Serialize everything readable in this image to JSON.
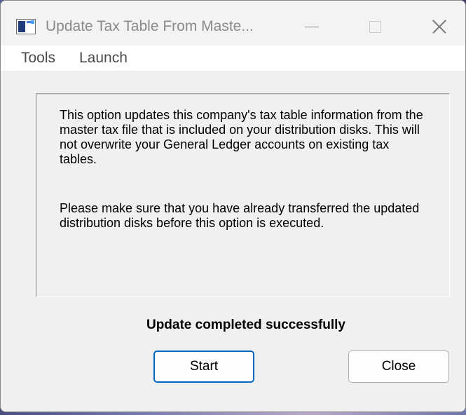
{
  "window": {
    "title": "Update Tax Table From Maste...",
    "controls": {
      "minimize_icon": "minimize-icon",
      "maximize_icon": "maximize-icon",
      "close_icon": "close-icon"
    }
  },
  "menu": {
    "items": [
      {
        "label": "Tools"
      },
      {
        "label": "Launch"
      }
    ]
  },
  "info": {
    "paragraph1": "This option updates this company's tax table information from the master tax file that is included on your distribution disks. This will not overwrite your General Ledger accounts on existing tax tables.",
    "paragraph2": "Please make sure that you have already transferred the updated distribution disks before this option is executed."
  },
  "status": {
    "message": "Update completed successfully"
  },
  "buttons": {
    "start_label": "Start",
    "close_label": "Close"
  },
  "colors": {
    "focus_border": "#0067c0",
    "window_bg": "#f0f0f0"
  }
}
